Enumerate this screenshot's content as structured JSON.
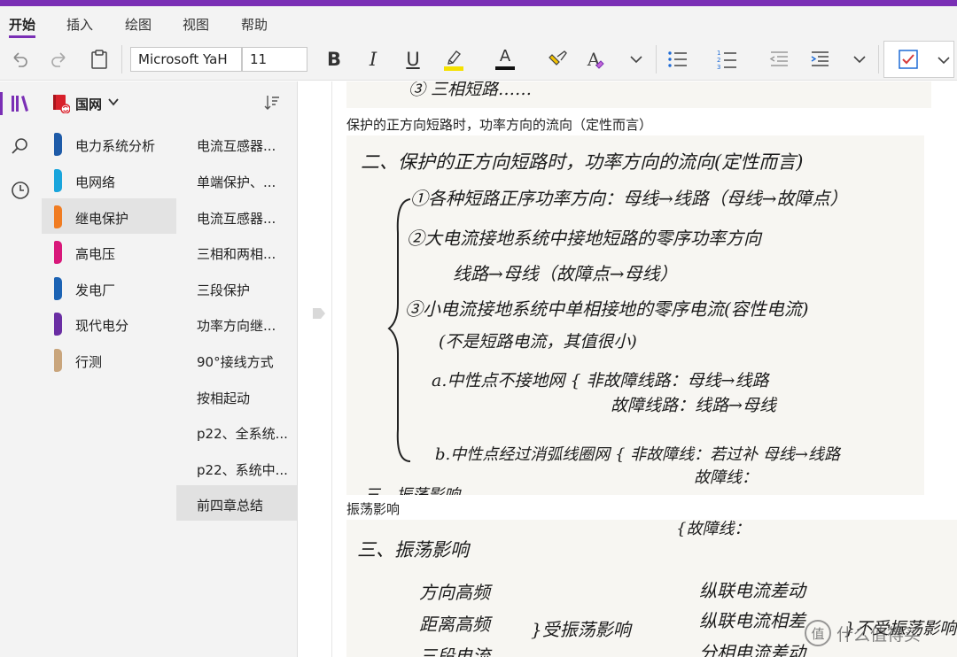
{
  "menubar": {
    "tabs": [
      {
        "label": "开始",
        "active": true
      },
      {
        "label": "插入"
      },
      {
        "label": "绘图"
      },
      {
        "label": "视图"
      },
      {
        "label": "帮助"
      }
    ]
  },
  "toolbar": {
    "font_name": "Microsoft YaH",
    "font_size": "11",
    "bold": "B",
    "italic": "I",
    "underline": "U",
    "font_color_letter": "A",
    "clear_format_letter": "A",
    "colors": {
      "highlight": "#f5e100",
      "font_color": "#111111",
      "accent": "#7a2fb5",
      "check": "#d63a3a",
      "checkbox_border": "#1e6bd6"
    }
  },
  "notebook": {
    "name": "国网"
  },
  "sections": [
    {
      "label": "电力系统分析",
      "color": "#1e5ba8"
    },
    {
      "label": "电网络",
      "color": "#19a5dc"
    },
    {
      "label": "继电保护",
      "color": "#f07c22",
      "selected": true
    },
    {
      "label": "高电压",
      "color": "#d8187a"
    },
    {
      "label": "发电厂",
      "color": "#1c63b4"
    },
    {
      "label": "现代电分",
      "color": "#6a2ea3"
    },
    {
      "label": "行测",
      "color": "#c9a57c"
    }
  ],
  "pages": [
    {
      "label": "电流互感器..."
    },
    {
      "label": "单端保护、..."
    },
    {
      "label": "电流互感器..."
    },
    {
      "label": "三相和两相..."
    },
    {
      "label": "三段保护"
    },
    {
      "label": "功率方向继..."
    },
    {
      "label": "90°接线方式"
    },
    {
      "label": "按相起动"
    },
    {
      "label": "p22、全系统..."
    },
    {
      "label": "p22、系统中..."
    },
    {
      "label": "前四章总结",
      "selected": true
    }
  ],
  "note": {
    "heading1": "保护的正方向短路时，功率方向的流向（定性而言）",
    "heading2": "振荡影响",
    "hw_top": "③ 三相短路……",
    "hw1": [
      "二、保护的正方向短路时，功率方向的流向(定性而言)",
      "①各种短路正序功率方向：母线→线路（母线→故障点）",
      "②大电流接地系统中接地短路的零序功率方向",
      "线路→母线（故障点→母线）",
      "③小电流接地系统中单相接地的零序电流(容性电流)",
      "(不是短路电流，其值很小)",
      "a.中性点不接地网 { 非故障线路：母线→线路",
      "故障线路：线路→母线",
      "b.中性点经过消弧线圈网 { 非故障线：若过补 母线→线路",
      "故障线：",
      "三、振荡影响"
    ],
    "hw2": [
      "{故障线：",
      "三、振荡影响",
      "方向高频",
      "距离高频",
      "三段电流",
      "}受振荡影响",
      "纵联电流差动",
      "纵联电流相差",
      "分相电流差动",
      "}不受振荡影响"
    ]
  },
  "watermark": "什么值得买"
}
